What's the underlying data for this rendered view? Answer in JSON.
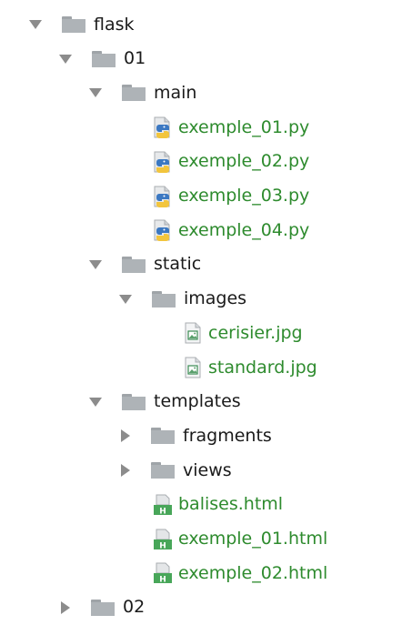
{
  "tree": [
    {
      "label": "flask",
      "kind": "folder",
      "state": "expanded",
      "color": "#1a1a1a",
      "name": "tree-folder-flask"
    },
    {
      "label": "01",
      "kind": "folder",
      "state": "expanded",
      "color": "#1a1a1a",
      "name": "tree-folder-01"
    },
    {
      "label": "main",
      "kind": "folder",
      "state": "expanded",
      "color": "#1a1a1a",
      "name": "tree-folder-main"
    },
    {
      "label": "exemple_01.py",
      "kind": "python",
      "color": "#2e8b2e",
      "name": "tree-file-exemple_01-py"
    },
    {
      "label": "exemple_02.py",
      "kind": "python",
      "color": "#2e8b2e",
      "name": "tree-file-exemple_02-py"
    },
    {
      "label": "exemple_03.py",
      "kind": "python",
      "color": "#2e8b2e",
      "name": "tree-file-exemple_03-py"
    },
    {
      "label": "exemple_04.py",
      "kind": "python",
      "color": "#2e8b2e",
      "name": "tree-file-exemple_04-py"
    },
    {
      "label": "static",
      "kind": "folder",
      "state": "expanded",
      "color": "#1a1a1a",
      "name": "tree-folder-static"
    },
    {
      "label": "images",
      "kind": "folder",
      "state": "expanded",
      "color": "#1a1a1a",
      "name": "tree-folder-images"
    },
    {
      "label": "cerisier.jpg",
      "kind": "image",
      "color": "#2e8b2e",
      "name": "tree-file-cerisier-jpg"
    },
    {
      "label": "standard.jpg",
      "kind": "image",
      "color": "#2e8b2e",
      "name": "tree-file-standard-jpg"
    },
    {
      "label": "templates",
      "kind": "folder",
      "state": "expanded",
      "color": "#1a1a1a",
      "name": "tree-folder-templates"
    },
    {
      "label": "fragments",
      "kind": "folder",
      "state": "collapsed",
      "color": "#1a1a1a",
      "name": "tree-folder-fragments"
    },
    {
      "label": "views",
      "kind": "folder",
      "state": "collapsed",
      "color": "#1a1a1a",
      "name": "tree-folder-views"
    },
    {
      "label": "balises.html",
      "kind": "html",
      "color": "#2e8b2e",
      "name": "tree-file-balises-html"
    },
    {
      "label": "exemple_01.html",
      "kind": "html",
      "color": "#2e8b2e",
      "name": "tree-file-exemple_01-html"
    },
    {
      "label": "exemple_02.html",
      "kind": "html",
      "color": "#2e8b2e",
      "name": "tree-file-exemple_02-html"
    },
    {
      "label": "02",
      "kind": "folder",
      "state": "collapsed",
      "color": "#1a1a1a",
      "name": "tree-folder-02"
    }
  ],
  "icons": {
    "expanded": "chevron-down-icon",
    "collapsed": "chevron-right-icon",
    "folder": "folder-icon",
    "python": "python-file-icon",
    "image": "image-file-icon",
    "html": "html-file-icon"
  }
}
